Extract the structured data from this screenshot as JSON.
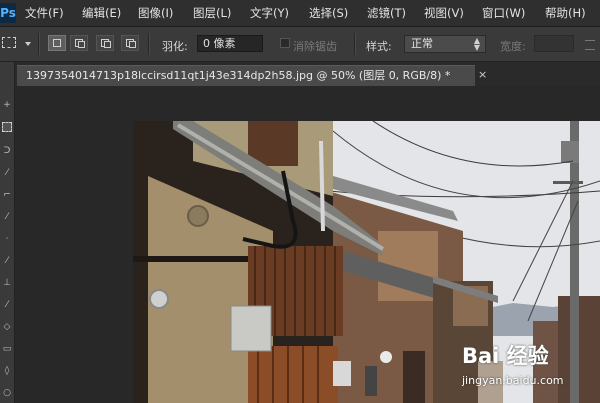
{
  "app": {
    "logo_text": "Ps"
  },
  "menu": [
    "文件(F)",
    "编辑(E)",
    "图像(I)",
    "图层(L)",
    "文字(Y)",
    "选择(S)",
    "滤镜(T)",
    "视图(V)",
    "窗口(W)",
    "帮助(H)"
  ],
  "options": {
    "feather_label": "羽化:",
    "feather_value": "0 像素",
    "antialias_label": "消除锯齿",
    "style_label": "样式:",
    "style_value": "正常",
    "width_label": "宽度:"
  },
  "document": {
    "tab_title": "1397354014713p18lccirsd11qt1j43e314dp2h58.jpg @ 50% (图层 0, RGB/8) *",
    "close_glyph": "×"
  },
  "watermark": {
    "logo_text": "Bai 经验",
    "url": "jingyan.baidu.com"
  },
  "colors": {
    "menubar": "#2f2f2f",
    "optionsbar": "#3a3a3a",
    "workspace": "#282828",
    "tab": "#4a4a4a"
  }
}
